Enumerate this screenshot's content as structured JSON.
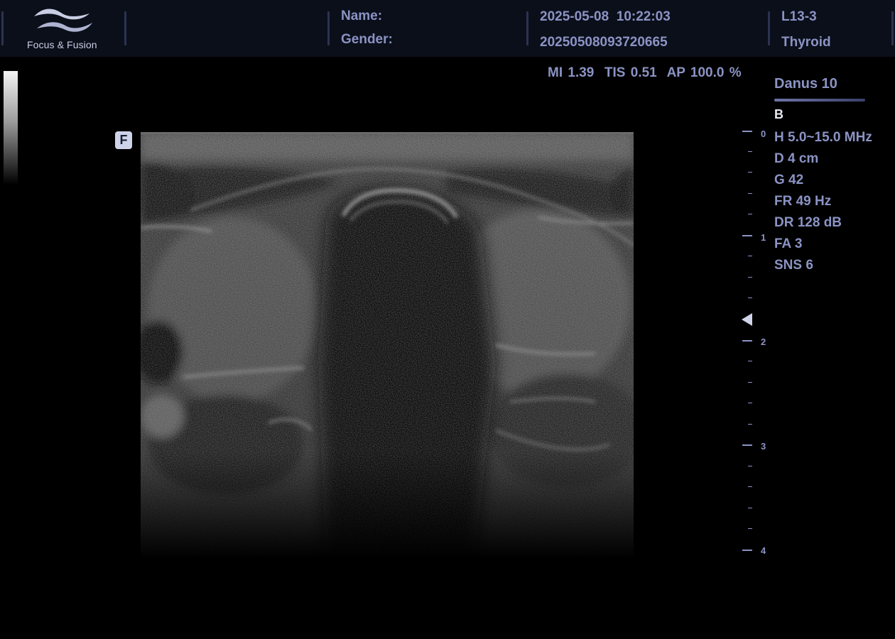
{
  "header": {
    "logo_text": "Focus & Fusion",
    "name_label": "Name:",
    "gender_label": "Gender:",
    "datetime": "2025-05-08  10:22:03",
    "exam_id": "20250508093720665",
    "probe": "L13-3",
    "preset": "Thyroid"
  },
  "acoustic": {
    "text": "MI 1.39  TIS 0.51  AP 100.0 %"
  },
  "image": {
    "focus_badge": "F"
  },
  "depth_scale": {
    "labels": [
      "0",
      "1",
      "2",
      "3",
      "4"
    ]
  },
  "side_panel": {
    "device": "Danus 10",
    "mode": "B",
    "params": [
      "H 5.0~15.0 MHz",
      "D 4 cm",
      "G 42",
      "FR 49 Hz",
      "DR 128 dB",
      "FA 3",
      "SNS 6"
    ]
  }
}
